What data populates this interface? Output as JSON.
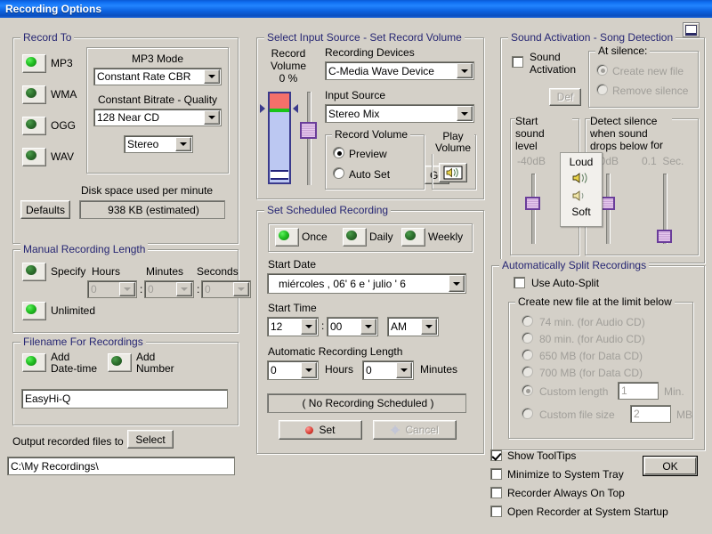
{
  "window": {
    "title": "Recording Options",
    "corner_icon": "screen-icon"
  },
  "colors": {
    "titlebar": "#0f6ef0",
    "face": "#d4d0c8",
    "group_label": "#262673",
    "disabled_text": "#a09e99",
    "led_on": "#23c023",
    "slider": "#6a3d9a"
  },
  "record_to": {
    "legend": "Record To",
    "formats": [
      {
        "label": "MP3",
        "on": true
      },
      {
        "label": "WMA",
        "on": false
      },
      {
        "label": "OGG",
        "on": false
      },
      {
        "label": "WAV",
        "on": false
      }
    ],
    "mp3_mode_label": "MP3 Mode",
    "mp3_mode_value": "Constant Rate CBR",
    "bitrate_label": "Constant Bitrate - Quality",
    "bitrate_value": "128   Near CD",
    "channels_value": "Stereo",
    "defaults_button": "Defaults",
    "disk_space_label": "Disk space used per minute",
    "disk_space_value": "938  KB (estimated)"
  },
  "manual_length": {
    "legend": "Manual Recording Length",
    "specify_label": "Specify",
    "hours_label": "Hours",
    "minutes_label": "Minutes",
    "seconds_label": "Seconds",
    "hours_value": "0",
    "minutes_value": "0",
    "seconds_value": "0",
    "colon": ":",
    "unlimited_label": "Unlimited",
    "specify_on": false,
    "unlimited_on": true
  },
  "filename": {
    "legend": "Filename For Recordings",
    "add_datetime_label": "Add\nDate-time",
    "add_number_label": "Add\nNumber",
    "add_datetime_on": true,
    "add_number_on": false,
    "name_value": "EasyHi-Q"
  },
  "output": {
    "label": "Output recorded files to",
    "select_button": "Select",
    "path_value": "C:\\My Recordings\\"
  },
  "input_source": {
    "legend": "Select Input Source - Set Record Volume",
    "record_volume_label": "Record\nVolume\n0 %",
    "devices_label": "Recording Devices",
    "devices_value": "C-Media Wave Device",
    "input_label": "Input Source",
    "input_value": "Stereo Mix",
    "record_volume_group": "Record Volume",
    "preview_label": "Preview",
    "auto_set_label": "Auto Set",
    "preview_selected": true,
    "go_button": "Go",
    "play_volume_label": "Play\nVolume",
    "play_volume_icon": "speaker-icon"
  },
  "scheduled": {
    "legend": "Set Scheduled Recording",
    "modes": [
      {
        "label": "Once",
        "on": true
      },
      {
        "label": "Daily",
        "on": false
      },
      {
        "label": "Weekly",
        "on": false
      }
    ],
    "start_date_label": "Start Date",
    "start_date_value": "miércoles   , 06'  6 e '    julio      '  6",
    "start_time_label": "Start Time",
    "hour_value": "12",
    "minute_value": "00",
    "ampm_value": "AM",
    "time_colon": ":",
    "auto_length_label": "Automatic Recording Length",
    "auto_hours_value": "0",
    "auto_hours_unit": "Hours",
    "auto_minutes_value": "0",
    "auto_minutes_unit": "Minutes",
    "status_value": "( No Recording Scheduled )",
    "set_button": "Set",
    "cancel_button": "Cancel"
  },
  "sound_activation": {
    "legend": "Sound Activation - Song Detection",
    "enable_label": "Sound\nActivation",
    "enabled": false,
    "def_button": "Def",
    "at_silence_label": "At silence:",
    "create_new_file_label": "Create new file",
    "remove_silence_label": "Remove silence",
    "create_new_file_selected": true,
    "start_level_label": "Start\nsound\nlevel",
    "start_level_value": "-40dB",
    "detect_label": "Detect silence\nwhen sound\ndrops below",
    "detect_value": "-40dB",
    "for_label": "for",
    "for_value": "0.1  Sec.",
    "loud_label": "Loud",
    "soft_label": "Soft"
  },
  "auto_split": {
    "legend": "Automatically Split Recordings",
    "use_label": "Use Auto-Split",
    "use_checked": false,
    "inner_legend": "Create new file at the limit below",
    "options": [
      {
        "label": "74 min. (for Audio CD)",
        "selected": false
      },
      {
        "label": "80 min. (for Audio CD)",
        "selected": false
      },
      {
        "label": "650 MB (for Data CD)",
        "selected": false
      },
      {
        "label": "700 MB (for Data CD)",
        "selected": false
      }
    ],
    "custom_length_label": "Custom length",
    "custom_length_value": "1",
    "custom_length_unit": "Min.",
    "custom_length_selected": true,
    "custom_size_label": "Custom file size",
    "custom_size_value": "2",
    "custom_size_unit": "MB",
    "custom_size_selected": false
  },
  "bottom": {
    "checkboxes": [
      {
        "label": "Show ToolTips",
        "checked": true
      },
      {
        "label": "Minimize to System Tray",
        "checked": false
      },
      {
        "label": "Recorder Always On Top",
        "checked": false
      },
      {
        "label": "Open Recorder at System Startup",
        "checked": false
      }
    ],
    "ok_button": "OK"
  }
}
